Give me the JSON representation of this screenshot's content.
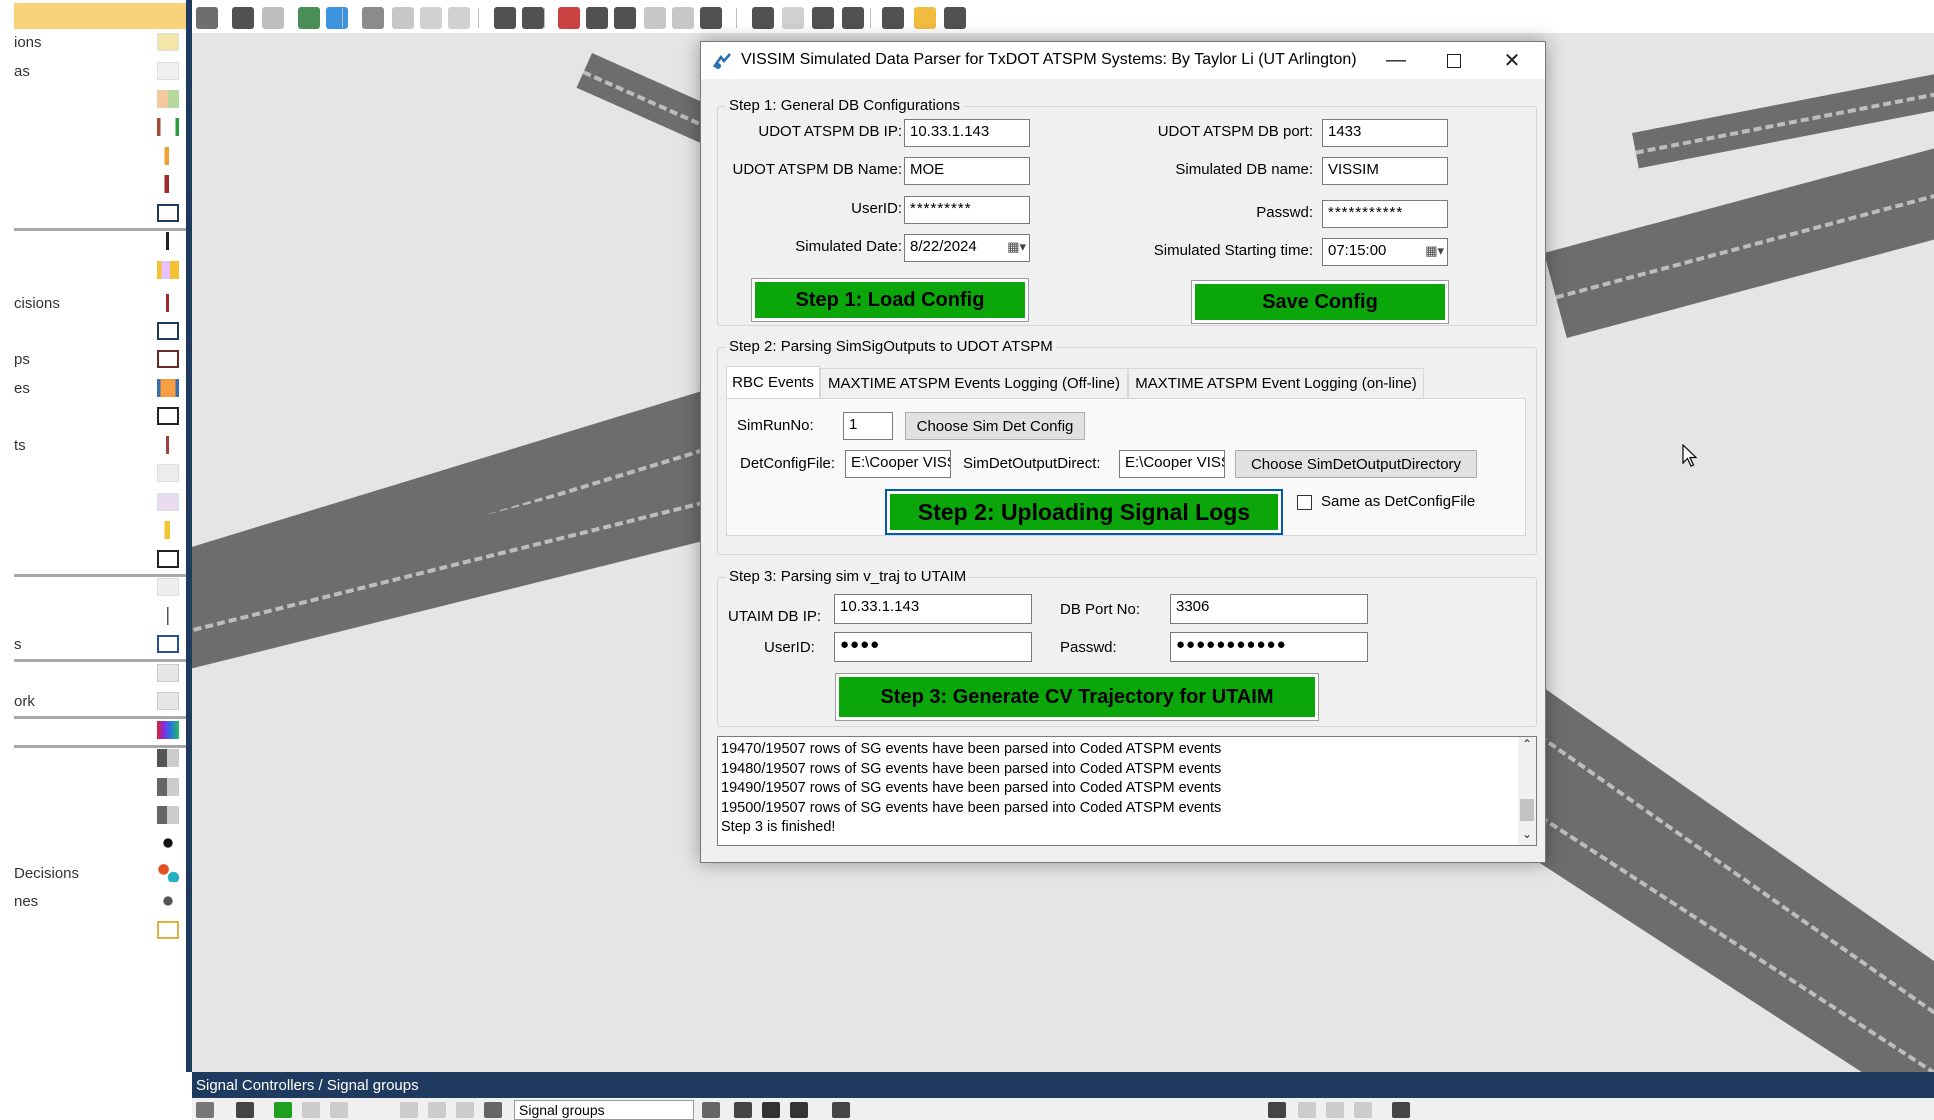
{
  "left_panel": {
    "items": [
      {
        "label": "ions"
      },
      {
        "label": "as"
      },
      {
        "label": ""
      },
      {
        "label": ""
      },
      {
        "label": ""
      },
      {
        "label": ""
      },
      {
        "label": ""
      },
      {
        "label": ""
      },
      {
        "label": ""
      },
      {
        "label": "cisions"
      },
      {
        "label": ""
      },
      {
        "label": "ps"
      },
      {
        "label": "es"
      },
      {
        "label": ""
      },
      {
        "label": "ts"
      },
      {
        "label": ""
      },
      {
        "label": ""
      },
      {
        "label": ""
      },
      {
        "label": ""
      },
      {
        "label": ""
      },
      {
        "label": ""
      },
      {
        "label": "s"
      },
      {
        "label": ""
      },
      {
        "label": "ork"
      },
      {
        "label": ""
      },
      {
        "label": ""
      },
      {
        "label": ""
      },
      {
        "label": ""
      },
      {
        "label": ""
      },
      {
        "label": "Decisions"
      },
      {
        "label": "nes"
      },
      {
        "label": ""
      }
    ]
  },
  "bottom_panel": {
    "title": "Signal Controllers / Signal groups",
    "list_select": "Signal groups"
  },
  "dialog": {
    "title": "VISSIM Simulated Data Parser for TxDOT ATSPM Systems: By Taylor Li (UT Arlington)",
    "step1": {
      "group_title": "Step 1: General DB Configurations",
      "db_ip_label": "UDOT ATSPM DB IP:",
      "db_ip_value": "10.33.1.143",
      "db_port_label": "UDOT ATSPM DB port:",
      "db_port_value": "1433",
      "db_name_label": "UDOT ATSPM DB Name:",
      "db_name_value": "MOE",
      "sim_db_label": "Simulated DB name:",
      "sim_db_value": "VISSIM",
      "userid_label": "UserID:",
      "userid_value": "*********",
      "passwd_label": "Passwd:",
      "passwd_value": "***********",
      "sim_date_label": "Simulated Date:",
      "sim_date_value": "8/22/2024",
      "sim_start_label": "Simulated Starting time:",
      "sim_start_value": "07:15:00",
      "load_button": "Step 1: Load Config",
      "save_button": "Save Config"
    },
    "step2": {
      "group_title": "Step 2: Parsing SimSigOutputs to UDOT ATSPM",
      "tabs": [
        {
          "label": "RBC Events"
        },
        {
          "label": "MAXTIME ATSPM Events Logging (Off-line)"
        },
        {
          "label": "MAXTIME ATSPM Event Logging (on-line)"
        }
      ],
      "simrun_label": "SimRunNo:",
      "simrun_value": "1",
      "choose_det_config_button": "Choose Sim Det Config",
      "detconfig_label": "DetConfigFile:",
      "detconfig_value": "E:\\Cooper VISSIM",
      "output_dir_label": "SimDetOutputDirect:",
      "output_dir_value": "E:\\Cooper VISSIM",
      "choose_output_dir_button": "Choose SimDetOutputDirectory",
      "upload_button": "Step 2: Uploading Signal Logs",
      "same_as_label": "Same as DetConfigFile"
    },
    "step3": {
      "group_title": "Step 3: Parsing sim v_traj to UTAIM",
      "ip_label": "UTAIM DB IP:",
      "ip_value": "10.33.1.143",
      "port_label": "DB Port No:",
      "port_value": "3306",
      "userid_label": "UserID:",
      "userid_value": "●●●●",
      "passwd_label": "Passwd:",
      "passwd_value": "●●●●●●●●●●●",
      "generate_button": "Step 3: Generate CV Trajectory for UTAIM"
    },
    "log": [
      "19470/19507 rows of SG events have been parsed into Coded ATSPM events",
      "19480/19507 rows of SG events have been parsed into Coded ATSPM events",
      "19490/19507 rows of SG events have been parsed into Coded ATSPM events",
      "19500/19507 rows of SG events have been parsed into Coded ATSPM events",
      "Step 3 is finished!"
    ]
  },
  "colors": {
    "green_button": "#0aa60a",
    "panel_blue": "#1f3a5f",
    "viewport_bg": "#e5e5e5",
    "road": "#6d6d6d"
  }
}
